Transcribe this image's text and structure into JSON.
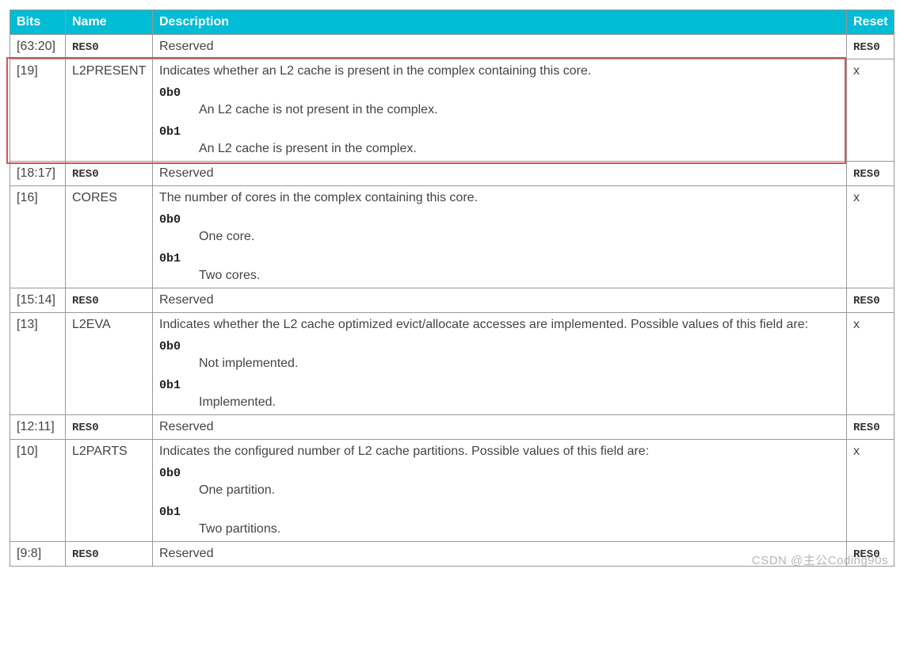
{
  "headers": {
    "bits": "Bits",
    "name": "Name",
    "description": "Description",
    "reset": "Reset"
  },
  "res0_label": "RES0",
  "rows": [
    {
      "bits": "[63:20]",
      "name_is_res0": true,
      "desc_intro": "Reserved",
      "values": [],
      "reset_is_res0": true
    },
    {
      "bits": "[19]",
      "name": "L2PRESENT",
      "desc_intro": "Indicates whether an L2 cache is present in the complex containing this core.",
      "values": [
        {
          "code": "0b0",
          "text": "An L2 cache is not present in the complex."
        },
        {
          "code": "0b1",
          "text": "An L2 cache is present in the complex."
        }
      ],
      "reset": "x",
      "highlighted": true
    },
    {
      "bits": "[18:17]",
      "name_is_res0": true,
      "desc_intro": "Reserved",
      "values": [],
      "reset_is_res0": true
    },
    {
      "bits": "[16]",
      "name": "CORES",
      "desc_intro": "The number of cores in the complex containing this core.",
      "values": [
        {
          "code": "0b0",
          "text": "One core."
        },
        {
          "code": "0b1",
          "text": "Two cores."
        }
      ],
      "reset": "x"
    },
    {
      "bits": "[15:14]",
      "name_is_res0": true,
      "desc_intro": "Reserved",
      "values": [],
      "reset_is_res0": true
    },
    {
      "bits": "[13]",
      "name": "L2EVA",
      "desc_intro": "Indicates whether the L2 cache optimized evict/allocate accesses are implemented. Possible values of this field are:",
      "values": [
        {
          "code": "0b0",
          "text": "Not implemented."
        },
        {
          "code": "0b1",
          "text": "Implemented."
        }
      ],
      "reset": "x"
    },
    {
      "bits": "[12:11]",
      "name_is_res0": true,
      "desc_intro": "Reserved",
      "values": [],
      "reset_is_res0": true
    },
    {
      "bits": "[10]",
      "name": "L2PARTS",
      "desc_intro": "Indicates the configured number of L2 cache partitions. Possible values of this field are:",
      "values": [
        {
          "code": "0b0",
          "text": "One partition."
        },
        {
          "code": "0b1",
          "text": "Two partitions."
        }
      ],
      "reset": "x"
    },
    {
      "bits": "[9:8]",
      "name_is_res0": true,
      "desc_intro": "Reserved",
      "values": [],
      "reset_is_res0": true
    }
  ],
  "watermark": "CSDN @主公Coding90s"
}
